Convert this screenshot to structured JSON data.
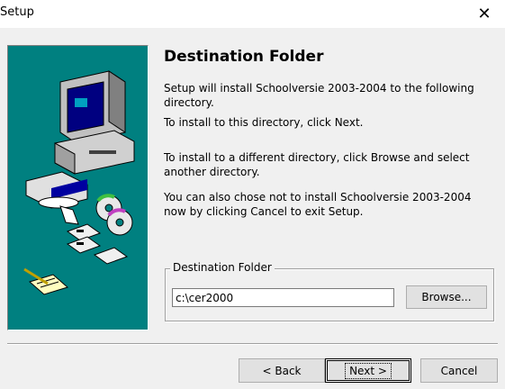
{
  "window": {
    "title": "Setup",
    "close_icon": "close-icon"
  },
  "artwork": {
    "description_icon": "computer-install-illustration",
    "background_color": "#008080"
  },
  "content": {
    "heading": "Destination Folder",
    "line1": "Setup will install Schoolversie 2003-2004 to the following directory.",
    "line2": "To install to this directory, click Next.",
    "line3": "To install to a different directory, click Browse and select another directory.",
    "line4": "You can also chose not to install Schoolversie 2003-2004 now by clicking Cancel to exit Setup."
  },
  "destination": {
    "group_label": "Destination Folder",
    "path_value": "c:\\cer2000",
    "browse_label": "Browse..."
  },
  "buttons": {
    "back_label": "< Back",
    "next_label": "Next >",
    "cancel_label": "Cancel"
  }
}
